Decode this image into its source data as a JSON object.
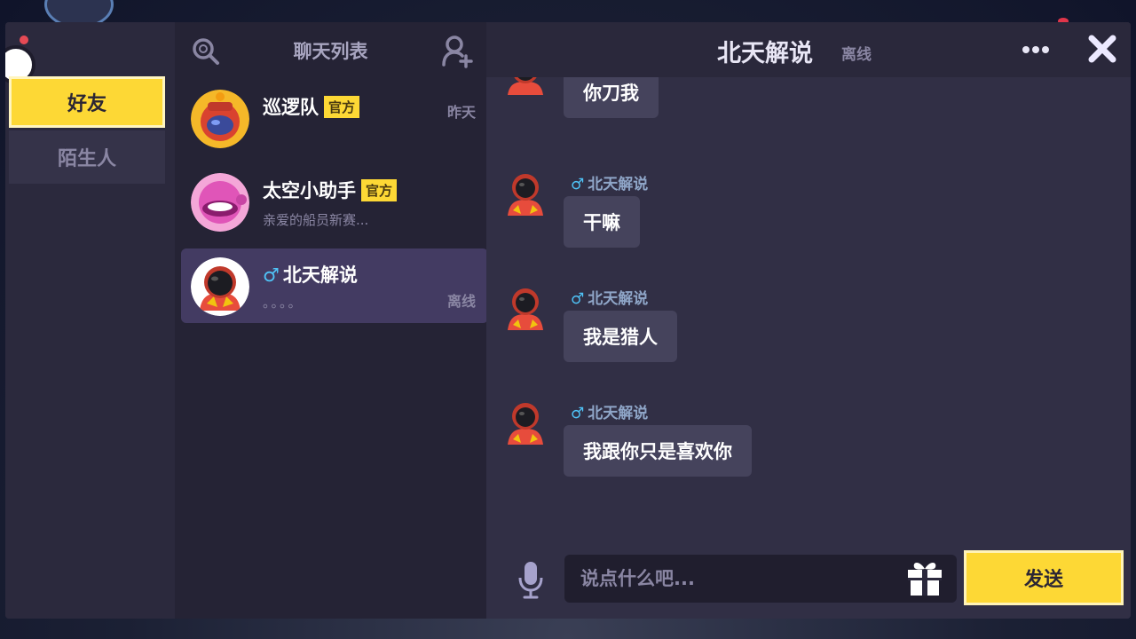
{
  "categories": {
    "friends_label": "好友",
    "strangers_label": "陌生人"
  },
  "chat_list": {
    "title": "聊天列表",
    "items": [
      {
        "name": "巡逻队",
        "badge": "官方",
        "preview": "",
        "time": "昨天",
        "status": ""
      },
      {
        "name": "太空小助手",
        "badge": "官方",
        "preview": "亲爱的船员新赛...",
        "time": "",
        "status": ""
      },
      {
        "gender": "♂",
        "name": "北天解说",
        "badge": "",
        "preview": "。。。。",
        "time": "",
        "status": "离线"
      }
    ]
  },
  "conversation": {
    "title": "北天解说",
    "status": "离线",
    "messages": [
      {
        "sender": "",
        "text": "你刀我"
      },
      {
        "gender": "♂",
        "sender": "北天解说",
        "text": "干嘛"
      },
      {
        "gender": "♂",
        "sender": "北天解说",
        "text": "我是猎人"
      },
      {
        "gender": "♂",
        "sender": "北天解说",
        "text": "我跟你只是喜欢你"
      }
    ]
  },
  "composer": {
    "placeholder": "说点什么吧...",
    "send_label": "发送"
  },
  "icons": {
    "search": "search-icon",
    "add_user": "add-user-icon",
    "more": "more-icon",
    "close": "close-icon",
    "mic": "microphone-icon",
    "gift": "gift-icon"
  },
  "colors": {
    "accent": "#fdd835",
    "male": "#4fc3f7",
    "panel": "#2b293d",
    "selected": "#433b62"
  }
}
